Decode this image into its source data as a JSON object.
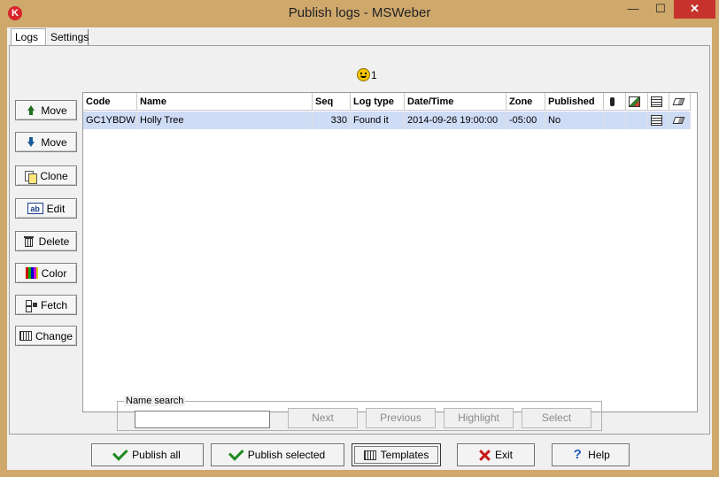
{
  "window": {
    "title": "Publish logs  - MSWeber",
    "minimize_glyph": "—",
    "maximize_glyph": "☐",
    "close_glyph": "✕",
    "app_icon_glyph": "K",
    "icon": "app-logo-icon"
  },
  "tabs": [
    {
      "label": "Logs",
      "active": true
    },
    {
      "label": "Settings",
      "active": false
    }
  ],
  "status": {
    "icon": "smiley-icon",
    "count": "1"
  },
  "side_buttons": [
    {
      "label": "Move",
      "icon": "arrow-up-icon"
    },
    {
      "label": "Move",
      "icon": "arrow-down-icon"
    },
    {
      "label": "Clone",
      "icon": "clone-icon"
    },
    {
      "label": "Edit",
      "icon": "edit-icon",
      "icon_text": "ab"
    },
    {
      "label": "Delete",
      "icon": "trash-icon"
    },
    {
      "label": "Color",
      "icon": "color-icon"
    },
    {
      "label": "Fetch",
      "icon": "fetch-icon"
    },
    {
      "label": "Change",
      "icon": "grid-icon"
    }
  ],
  "table": {
    "columns": [
      "Code",
      "Name",
      "Seq",
      "Log type",
      "Date/Time",
      "Zone",
      "Published"
    ],
    "icon_columns": [
      "travelbug-icon",
      "image-icon",
      "note-icon",
      "eraser-icon"
    ],
    "rows": [
      {
        "code": "GC1YBDW",
        "name": "Holly Tree",
        "seq": "330",
        "log_type": "Found it",
        "datetime": "2014-09-26 19:00:00",
        "zone": "-05:00",
        "published": "No",
        "has_note": true,
        "has_eraser": true
      }
    ]
  },
  "search": {
    "label": "Name search",
    "value": "",
    "buttons": [
      "Next",
      "Previous",
      "Highlight",
      "Select"
    ]
  },
  "bottom_buttons": [
    {
      "label": "Publish all",
      "icon": "checkmark-icon"
    },
    {
      "label": "Publish selected",
      "icon": "checkmark-icon"
    },
    {
      "label": "Templates",
      "icon": "grid-icon"
    },
    {
      "label": "Exit",
      "icon": "x-icon"
    },
    {
      "label": "Help",
      "icon": "question-icon",
      "icon_text": "?"
    }
  ]
}
